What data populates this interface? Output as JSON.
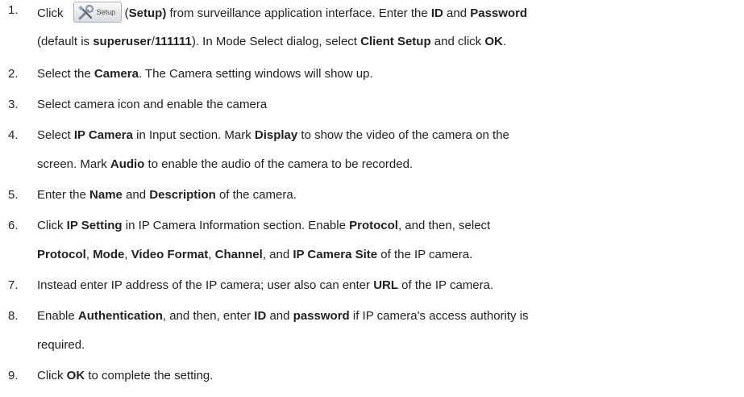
{
  "steps": [
    {
      "num": "1.",
      "lines": [
        [
          {
            "t": "Click "
          },
          {
            "button": true
          },
          {
            "t": "(",
            "b": false
          },
          {
            "t": "Setup)",
            "b": true
          },
          {
            "t": " from surveillance application interface. Enter the "
          },
          {
            "t": "ID",
            "b": true
          },
          {
            "t": " and "
          },
          {
            "t": "Password",
            "b": true
          }
        ],
        [
          {
            "t": "(default is "
          },
          {
            "t": "superuser",
            "b": true
          },
          {
            "t": "/"
          },
          {
            "t": "111111",
            "b": true
          },
          {
            "t": "). In Mode Select dialog, select "
          },
          {
            "t": "Client Setup",
            "b": true
          },
          {
            "t": " and click "
          },
          {
            "t": "OK",
            "b": true
          },
          {
            "t": "."
          }
        ]
      ]
    },
    {
      "num": "2.",
      "lines": [
        [
          {
            "t": "Select the "
          },
          {
            "t": "Camera",
            "b": true
          },
          {
            "t": ". The Camera setting windows will show up."
          }
        ]
      ]
    },
    {
      "num": "3.",
      "lines": [
        [
          {
            "t": "Select camera icon and enable the camera"
          }
        ]
      ]
    },
    {
      "num": "4.",
      "lines": [
        [
          {
            "t": "Select "
          },
          {
            "t": "IP Camera",
            "b": true
          },
          {
            "t": " in Input section. Mark "
          },
          {
            "t": "Display",
            "b": true
          },
          {
            "t": " to show the video of the camera on the"
          }
        ],
        [
          {
            "t": "screen. Mark "
          },
          {
            "t": "Audio",
            "b": true
          },
          {
            "t": " to enable the audio of the camera to be recorded."
          }
        ]
      ]
    },
    {
      "num": "5.",
      "lines": [
        [
          {
            "t": "Enter the "
          },
          {
            "t": "Name",
            "b": true
          },
          {
            "t": " and "
          },
          {
            "t": "Description",
            "b": true
          },
          {
            "t": " of the camera."
          }
        ]
      ]
    },
    {
      "num": "6.",
      "lines": [
        [
          {
            "t": "Click "
          },
          {
            "t": "IP Setting",
            "b": true
          },
          {
            "t": " in IP Camera Information section. Enable "
          },
          {
            "t": "Protocol",
            "b": true
          },
          {
            "t": ", and then, select"
          }
        ],
        [
          {
            "t": "Protocol",
            "b": true
          },
          {
            "t": ", "
          },
          {
            "t": "Mode",
            "b": true
          },
          {
            "t": ", "
          },
          {
            "t": "Video Format",
            "b": true
          },
          {
            "t": ", "
          },
          {
            "t": "Channel",
            "b": true
          },
          {
            "t": ", and "
          },
          {
            "t": "IP Camera Site",
            "b": true
          },
          {
            "t": " of the IP camera."
          }
        ]
      ]
    },
    {
      "num": "7.",
      "lines": [
        [
          {
            "t": "Instead enter IP address of the IP camera; user also can enter "
          },
          {
            "t": "URL",
            "b": true
          },
          {
            "t": " of the IP camera."
          }
        ]
      ]
    },
    {
      "num": "8.",
      "lines": [
        [
          {
            "t": "Enable "
          },
          {
            "t": "Authentication",
            "b": true
          },
          {
            "t": ", and then, enter "
          },
          {
            "t": "ID",
            "b": true
          },
          {
            "t": " and "
          },
          {
            "t": "password",
            "b": true
          },
          {
            "t": " if IP camera's access authority is"
          }
        ],
        [
          {
            "t": "required."
          }
        ]
      ]
    },
    {
      "num": "9.",
      "lines": [
        [
          {
            "t": "Click "
          },
          {
            "t": "OK",
            "b": true
          },
          {
            "t": " to complete the setting."
          }
        ]
      ]
    }
  ],
  "setup_button": {
    "label": "Setup",
    "icon": "tools-icon"
  }
}
